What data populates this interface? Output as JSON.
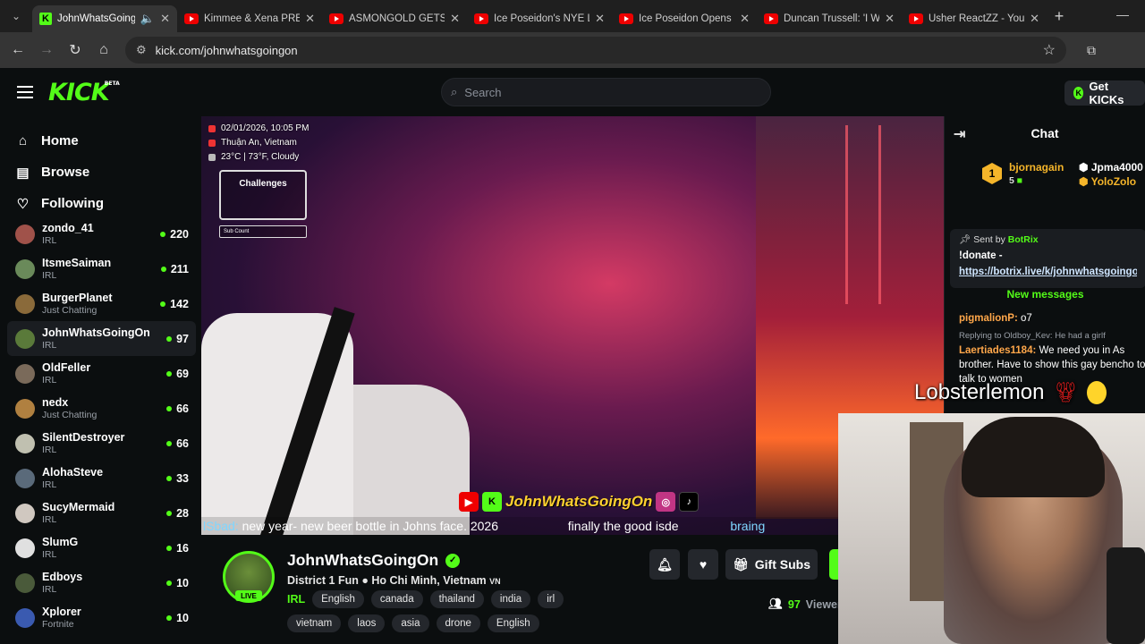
{
  "browser": {
    "tabs": [
      {
        "title": "JohnWhatsGoingOn",
        "favicon": "kick-icon",
        "active": true
      },
      {
        "title": "Kimmee & Xena PRE",
        "favicon": "youtube-icon"
      },
      {
        "title": "ASMONGOLD GETS /",
        "favicon": "youtube-icon"
      },
      {
        "title": "Ice Poseidon's NYE L",
        "favicon": "youtube-icon"
      },
      {
        "title": "Ice Poseidon Opens",
        "favicon": "youtube-icon"
      },
      {
        "title": "Duncan Trussell: 'I W",
        "favicon": "youtube-icon"
      },
      {
        "title": "Usher ReactZZ - You",
        "favicon": "youtube-icon"
      }
    ],
    "url": "kick.com/johnwhatsgoingon"
  },
  "header": {
    "logo": "KICK",
    "logo_badge": "BETA",
    "search_placeholder": "Search",
    "get_kicks": "Get KICKs"
  },
  "sidebar": {
    "nav": [
      {
        "label": "Home",
        "icon": "home-icon"
      },
      {
        "label": "Browse",
        "icon": "browse-icon"
      },
      {
        "label": "Following",
        "icon": "heart-icon"
      }
    ],
    "channels": [
      {
        "name": "zondo_41",
        "category": "IRL",
        "viewers": "220",
        "color": "#a0524a"
      },
      {
        "name": "ItsmeSaiman",
        "category": "IRL",
        "viewers": "211",
        "color": "#6a8a5a"
      },
      {
        "name": "BurgerPlanet",
        "category": "Just Chatting",
        "viewers": "142",
        "color": "#8a6a3a"
      },
      {
        "name": "JohnWhatsGoingOn",
        "category": "IRL",
        "viewers": "97",
        "color": "#5a7a3a"
      },
      {
        "name": "OldFeller",
        "category": "IRL",
        "viewers": "69",
        "color": "#7a6a5a"
      },
      {
        "name": "nedx",
        "category": "Just Chatting",
        "viewers": "66",
        "color": "#b08040"
      },
      {
        "name": "SilentDestroyer",
        "category": "IRL",
        "viewers": "66",
        "color": "#c0c0b0"
      },
      {
        "name": "AlohaSteve",
        "category": "IRL",
        "viewers": "33",
        "color": "#5a6a7a"
      },
      {
        "name": "SucyMermaid",
        "category": "IRL",
        "viewers": "28",
        "color": "#d0c8c0"
      },
      {
        "name": "SlumG",
        "category": "IRL",
        "viewers": "16",
        "color": "#e0e0e0"
      },
      {
        "name": "Edboys",
        "category": "IRL",
        "viewers": "10",
        "color": "#4a5a3a"
      },
      {
        "name": "Xplorer",
        "category": "Fortnite",
        "viewers": "10",
        "color": "#3a5ab0"
      }
    ]
  },
  "player": {
    "overlay_datetime": "02/01/2026, 10:05 PM",
    "overlay_location": "Thuận An, Vietnam",
    "overlay_weather": "23°C | 73°F, Cloudy",
    "challenges_title": "Challenges",
    "sub_count_label": "Sub Count",
    "brand_name": "JohnWhatsGoingOn",
    "ticker_user": "lSbad:",
    "ticker_text": "new year- new beer bottle in Johns face. 2026",
    "ticker_text2": "finally the good isde",
    "ticker_text3": "braing"
  },
  "stream": {
    "channel_name": "JohnWhatsGoingOn",
    "title": "District 1 Fun ● Ho Chi Minh, Vietnam",
    "title_suffix": "VN",
    "category": "IRL",
    "tags": [
      "English",
      "canada",
      "thailand",
      "india",
      "irl",
      "vietnam",
      "laos",
      "asia",
      "drone",
      "English"
    ],
    "live_label": "LIVE",
    "gift_subs_label": "Gift Subs",
    "viewers_count": "97",
    "viewers_label": "Viewer"
  },
  "chat": {
    "title": "Chat",
    "leaderboard": {
      "rank": "1",
      "top_user": "bjornagain",
      "top_count": "5",
      "second_user": "Jpma4000",
      "third_user": "YoloZolo"
    },
    "pinned_by_label": "Sent by",
    "pinned_by": "BotRix",
    "pinned_message": "!donate -",
    "pinned_link": "https://botrix.live/k/johnwhatsgoingon",
    "new_messages_label": "New messages",
    "messages": [
      {
        "reply": "",
        "user": "pigmalionP:",
        "text": "o7"
      },
      {
        "reply": "Replying to Oldboy_Kev: He had a girlf",
        "user": "Laertiades1184:",
        "text": "We need you in As brother. Have to show this gay bencho to talk to women"
      }
    ]
  },
  "webcam": {
    "name": "Lobsterlemon"
  },
  "colors": {
    "accent": "#53fc18",
    "background": "#0b0e0f",
    "panel": "#24272c"
  }
}
